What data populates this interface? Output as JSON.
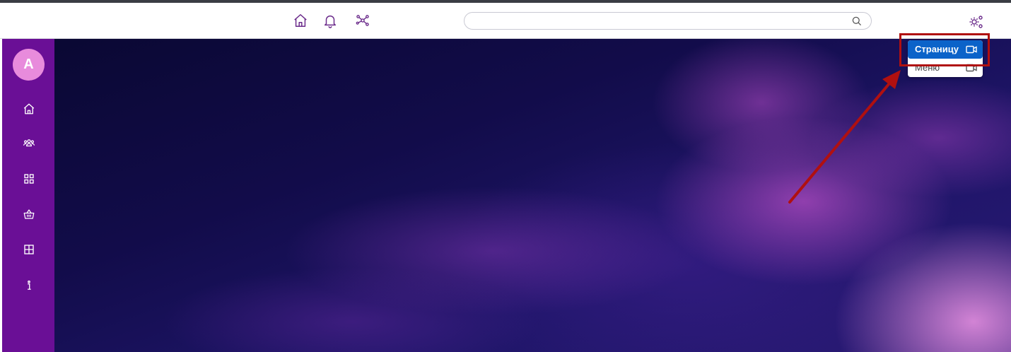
{
  "topbar": {
    "icons": {
      "home": "home-icon",
      "notifications": "bell-icon",
      "network": "network-icon",
      "settings": "gear-icon"
    },
    "search": {
      "value": "",
      "placeholder": "",
      "icon": "search-icon"
    }
  },
  "sidebar": {
    "avatar_initial": "A",
    "items": [
      {
        "name": "home",
        "icon": "home-icon"
      },
      {
        "name": "community",
        "icon": "people-icon"
      },
      {
        "name": "apps",
        "icon": "grid-icon"
      },
      {
        "name": "shop",
        "icon": "basket-icon"
      },
      {
        "name": "layout",
        "icon": "layout-icon"
      },
      {
        "name": "info",
        "icon": "info-icon"
      }
    ],
    "background": "#6a0f96",
    "avatar_color": "#e88bdc"
  },
  "dropdown": {
    "items": [
      {
        "label": "Страницу",
        "icon": "video-icon",
        "active": true
      },
      {
        "label": "Меню",
        "icon": "video-icon",
        "active": false
      }
    ],
    "active_color": "#0b63c9"
  },
  "annotation": {
    "highlight_color": "#b01010"
  }
}
